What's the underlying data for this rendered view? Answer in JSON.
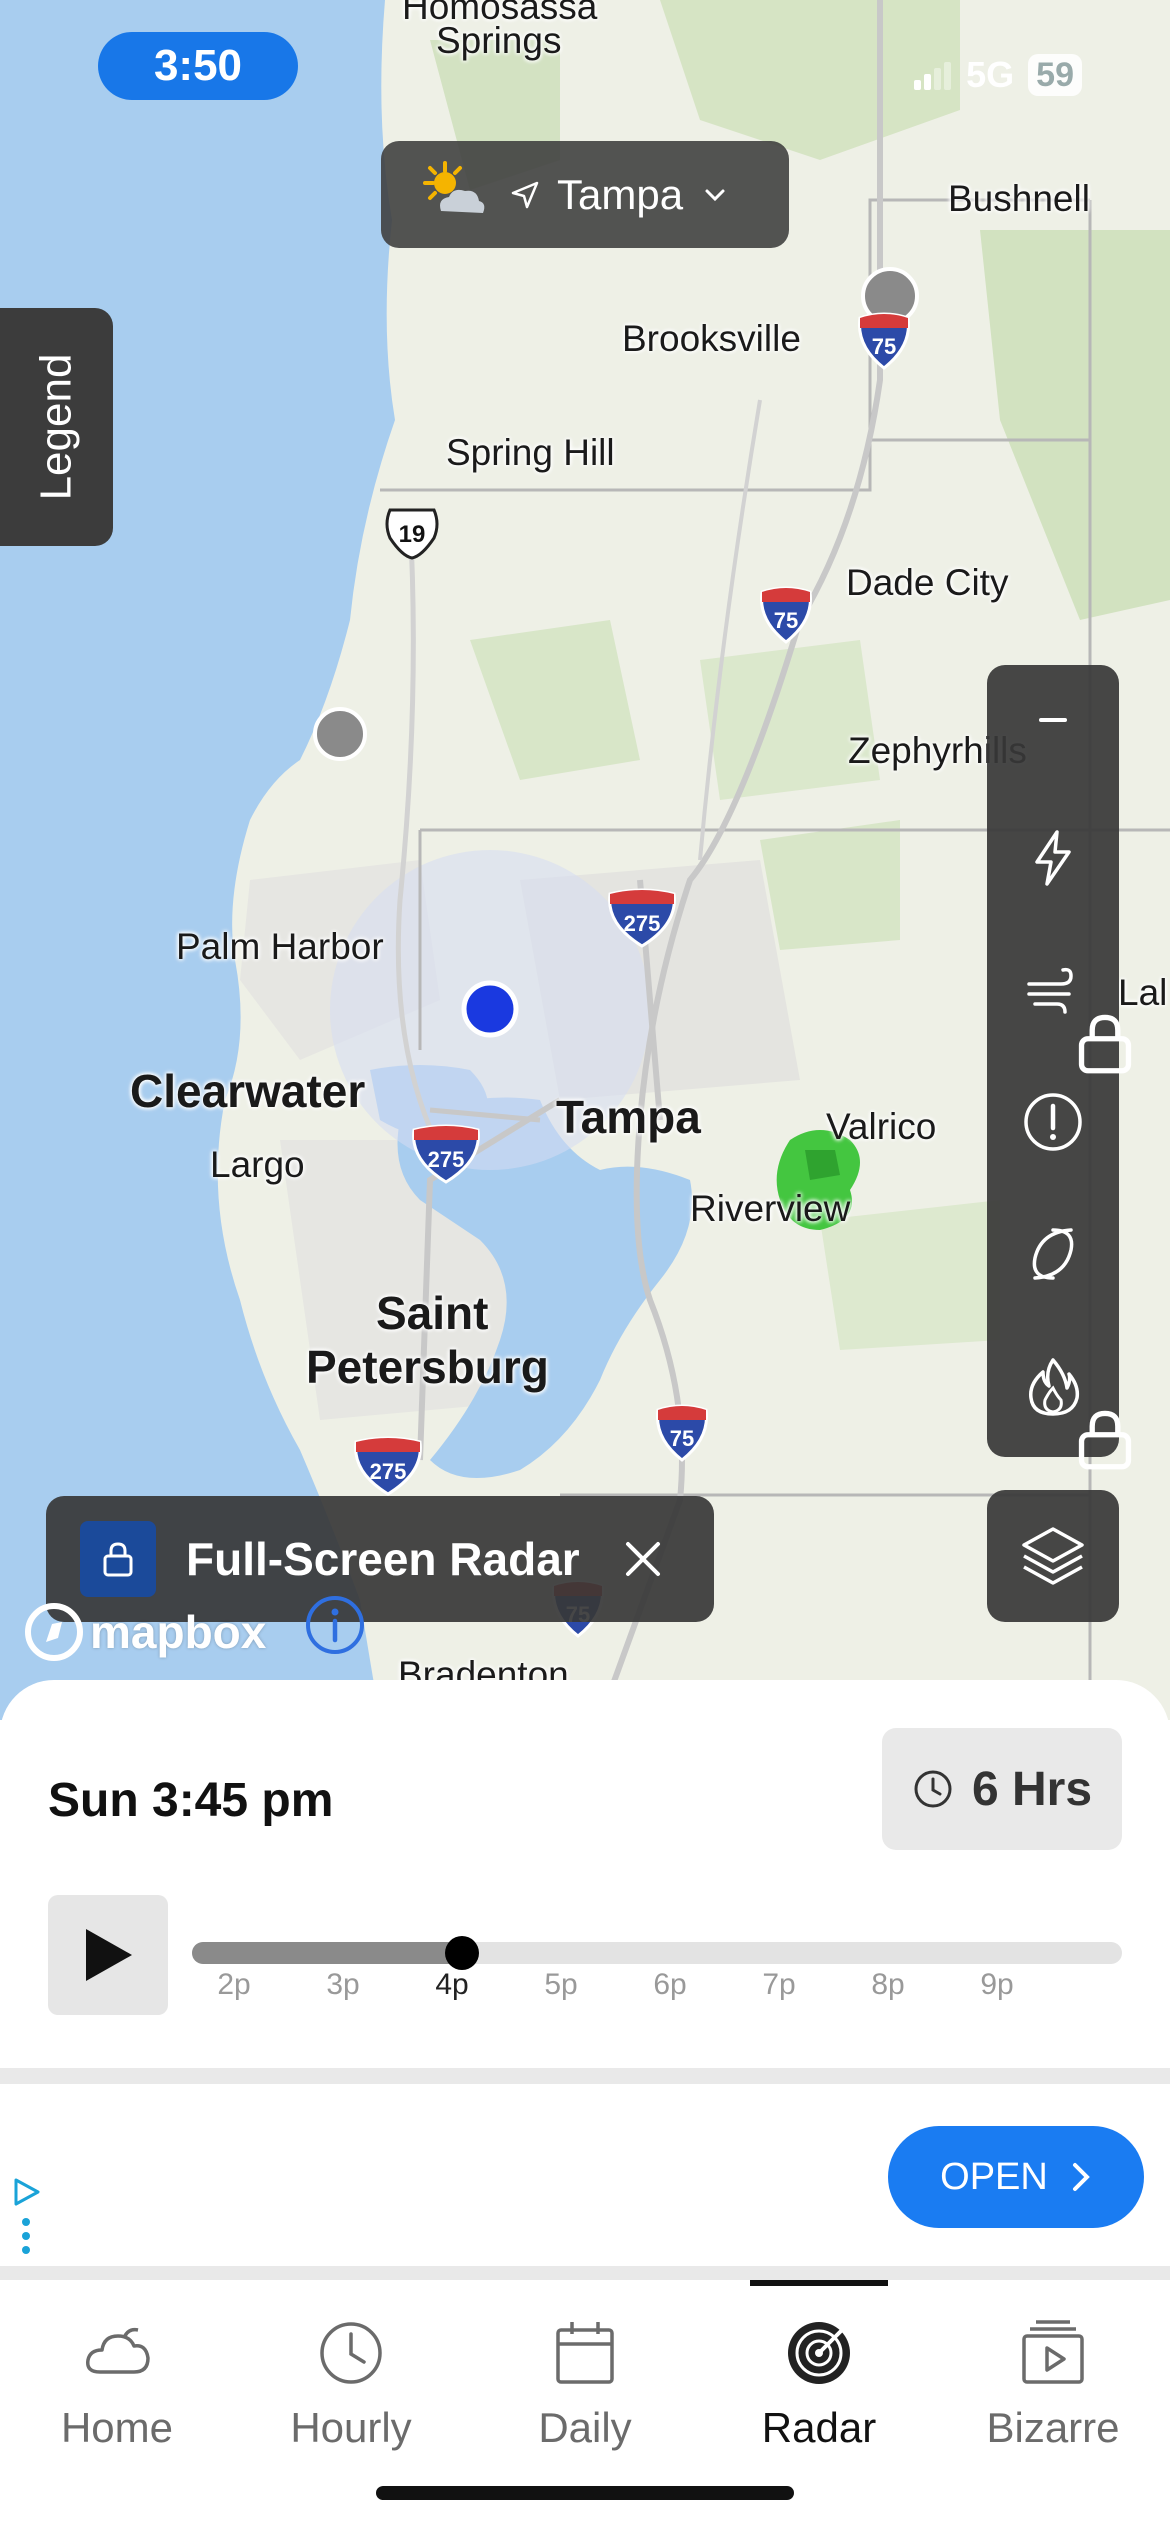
{
  "status_bar": {
    "time": "3:50",
    "network": "5G",
    "battery": "59"
  },
  "location": {
    "name": "Tampa",
    "weather_icon": "partly-sunny-icon"
  },
  "legend_tab": {
    "label": "Legend"
  },
  "map": {
    "places": [
      {
        "label": "Homosassa",
        "size": "sm"
      },
      {
        "label": "Springs",
        "size": "sm"
      },
      {
        "label": "Bushnell",
        "size": "sm"
      },
      {
        "label": "Brooksville",
        "size": "sm"
      },
      {
        "label": "Spring Hill",
        "size": "sm"
      },
      {
        "label": "Dade City",
        "size": "sm"
      },
      {
        "label": "Zephyrhills",
        "size": "sm"
      },
      {
        "label": "Palm Harbor",
        "size": "sm"
      },
      {
        "label": "Clearwater",
        "size": "lg"
      },
      {
        "label": "Tampa",
        "size": "lg"
      },
      {
        "label": "Valrico",
        "size": "sm"
      },
      {
        "label": "Largo",
        "size": "sm"
      },
      {
        "label": "Riverview",
        "size": "sm"
      },
      {
        "label": "Saint",
        "size": "lg"
      },
      {
        "label": "Petersburg",
        "size": "lg"
      },
      {
        "label": "Lal",
        "size": "sm"
      },
      {
        "label": "Bradenton",
        "size": "sm"
      }
    ],
    "shields": [
      "75",
      "19",
      "75",
      "275",
      "275",
      "75",
      "275",
      "75"
    ],
    "attribution": "mapbox"
  },
  "tools": [
    {
      "name": "collapse",
      "icon": "minus-icon",
      "locked": false
    },
    {
      "name": "lightning",
      "icon": "lightning-icon",
      "locked": false
    },
    {
      "name": "wind",
      "icon": "wind-icon",
      "locked": true
    },
    {
      "name": "alerts",
      "icon": "alert-icon",
      "locked": false
    },
    {
      "name": "tropical",
      "icon": "hurricane-icon",
      "locked": false
    },
    {
      "name": "fire",
      "icon": "fire-icon",
      "locked": true
    }
  ],
  "layers_button": {
    "icon": "layers-icon"
  },
  "fullscreen_banner": {
    "label": "Full-Screen Radar"
  },
  "timeline": {
    "timestamp": "Sun 3:45 pm",
    "range_label": "6 Hrs",
    "ticks": [
      "2p",
      "3p",
      "4p",
      "5p",
      "6p",
      "7p",
      "8p",
      "9p"
    ],
    "current_tick_index": 2,
    "progress_fraction": 0.29
  },
  "ad": {
    "cta": "OPEN"
  },
  "tabs": [
    {
      "label": "Home",
      "icon": "cloud-icon",
      "active": false
    },
    {
      "label": "Hourly",
      "icon": "clock-icon",
      "active": false
    },
    {
      "label": "Daily",
      "icon": "calendar-icon",
      "active": false
    },
    {
      "label": "Radar",
      "icon": "radar-icon",
      "active": true
    },
    {
      "label": "Bizarre",
      "icon": "video-icon",
      "active": false
    }
  ]
}
